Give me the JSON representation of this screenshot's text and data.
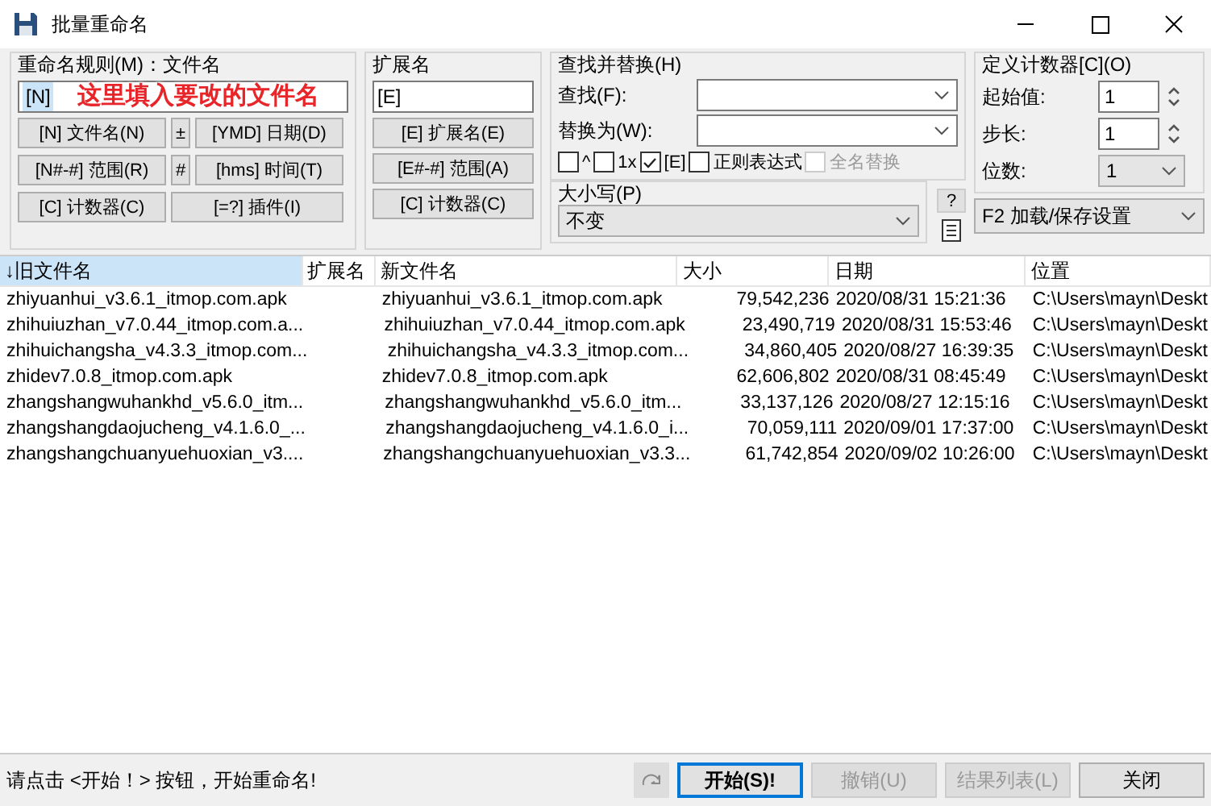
{
  "window": {
    "title": "批量重命名"
  },
  "rename_rule": {
    "label": "重命名规则(M)：文件名",
    "value": "[N]",
    "annotation": "这里填入要改的文件名",
    "buttons": [
      {
        "label": "[N] 文件名(N)",
        "kind": "wide"
      },
      {
        "label": "±",
        "kind": "narrow"
      },
      {
        "label": "[YMD] 日期(D)",
        "kind": "wide"
      },
      {
        "label": "[N#-#] 范围(R)",
        "kind": "wide"
      },
      {
        "label": "#",
        "kind": "narrow"
      },
      {
        "label": "[hms] 时间(T)",
        "kind": "wide"
      },
      {
        "label": "[C] 计数器(C)",
        "kind": "wide"
      },
      {
        "label": "[=?] 插件(I)",
        "kind": "span"
      }
    ]
  },
  "extension_rule": {
    "label": "扩展名",
    "value": "[E]",
    "buttons": [
      "[E] 扩展名(E)",
      "[E#-#] 范围(A)",
      "[C] 计数器(C)"
    ]
  },
  "find_replace": {
    "title": "查找并替换(H)",
    "find_label": "查找(F):",
    "replace_label": "替换为(W):",
    "options": [
      {
        "label": "^",
        "checked": false,
        "disabled": false
      },
      {
        "label": "1x",
        "checked": false,
        "disabled": false
      },
      {
        "label": "[E]",
        "checked": true,
        "disabled": false
      },
      {
        "label": "正则表达式",
        "checked": false,
        "disabled": false
      },
      {
        "label": "全名替换",
        "checked": false,
        "disabled": true
      }
    ],
    "case_label": "大小写(P)",
    "case_value": "不变",
    "help_button": "?"
  },
  "counter": {
    "title": "定义计数器[C](O)",
    "start_label": "起始值:",
    "start_value": "1",
    "step_label": "步长:",
    "step_value": "1",
    "digits_label": "位数:",
    "digits_value": "1",
    "settings": "F2 加载/保存设置"
  },
  "table": {
    "columns": [
      {
        "label": "↓旧文件名",
        "selected": true
      },
      {
        "label": "扩展名",
        "selected": false
      },
      {
        "label": "新文件名",
        "selected": false
      },
      {
        "label": "大小",
        "selected": false
      },
      {
        "label": "日期",
        "selected": false
      },
      {
        "label": "位置",
        "selected": false
      }
    ],
    "rows": [
      [
        "zhiyuanhui_v3.6.1_itmop.com.apk",
        "",
        "zhiyuanhui_v3.6.1_itmop.com.apk",
        "79,542,236",
        "2020/08/31 15:21:36",
        "C:\\Users\\mayn\\Deskt"
      ],
      [
        "zhihuiuzhan_v7.0.44_itmop.com.a...",
        "",
        "zhihuiuzhan_v7.0.44_itmop.com.apk",
        "23,490,719",
        "2020/08/31 15:53:46",
        "C:\\Users\\mayn\\Deskt"
      ],
      [
        "zhihuichangsha_v4.3.3_itmop.com...",
        "",
        "zhihuichangsha_v4.3.3_itmop.com...",
        "34,860,405",
        "2020/08/27 16:39:35",
        "C:\\Users\\mayn\\Deskt"
      ],
      [
        "zhidev7.0.8_itmop.com.apk",
        "",
        "zhidev7.0.8_itmop.com.apk",
        "62,606,802",
        "2020/08/31 08:45:49",
        "C:\\Users\\mayn\\Deskt"
      ],
      [
        "zhangshangwuhankhd_v5.6.0_itm...",
        "",
        "zhangshangwuhankhd_v5.6.0_itm...",
        "33,137,126",
        "2020/08/27 12:15:16",
        "C:\\Users\\mayn\\Deskt"
      ],
      [
        "zhangshangdaojucheng_v4.1.6.0_...",
        "",
        "zhangshangdaojucheng_v4.1.6.0_i...",
        "70,059,111",
        "2020/09/01 17:37:00",
        "C:\\Users\\mayn\\Deskt"
      ],
      [
        "zhangshangchuanyuehuoxian_v3....",
        "",
        "zhangshangchuanyuehuoxian_v3.3...",
        "61,742,854",
        "2020/09/02 10:26:00",
        "C:\\Users\\mayn\\Deskt"
      ]
    ]
  },
  "status_bar": {
    "message": "请点击 <开始！> 按钮，开始重命名!",
    "buttons": [
      {
        "label": "开始(S)!",
        "kind": "default",
        "disabled": false
      },
      {
        "label": "撤销(U)",
        "kind": "normal",
        "disabled": true
      },
      {
        "label": "结果列表(L)",
        "kind": "normal",
        "disabled": true
      },
      {
        "label": "关闭",
        "kind": "normal",
        "disabled": false
      }
    ]
  }
}
